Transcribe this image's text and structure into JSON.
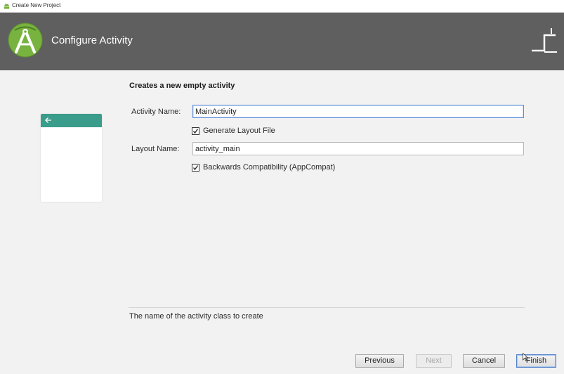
{
  "window": {
    "title": "Create New Project",
    "app_icon": "android-icon"
  },
  "banner": {
    "title": "Configure Activity",
    "logo_icon": "android-studio-logo",
    "corner_icon": "activity-template-icon",
    "background": "#5f5f5f"
  },
  "preview": {
    "bar_color": "#3a9c8a",
    "back_icon": "back-arrow-icon"
  },
  "form": {
    "heading": "Creates a new empty activity",
    "activity_name": {
      "label": "Activity Name:",
      "value": "MainActivity"
    },
    "generate_layout": {
      "label": "Generate Layout File",
      "checked": true
    },
    "layout_name": {
      "label": "Layout Name:",
      "value": "activity_main"
    },
    "backwards_compat": {
      "label": "Backwards Compatibility (AppCompat)",
      "checked": true
    },
    "hint": "The name of the activity class to create"
  },
  "buttons": {
    "previous": "Previous",
    "next": "Next",
    "cancel": "Cancel",
    "finish": "Finish"
  }
}
